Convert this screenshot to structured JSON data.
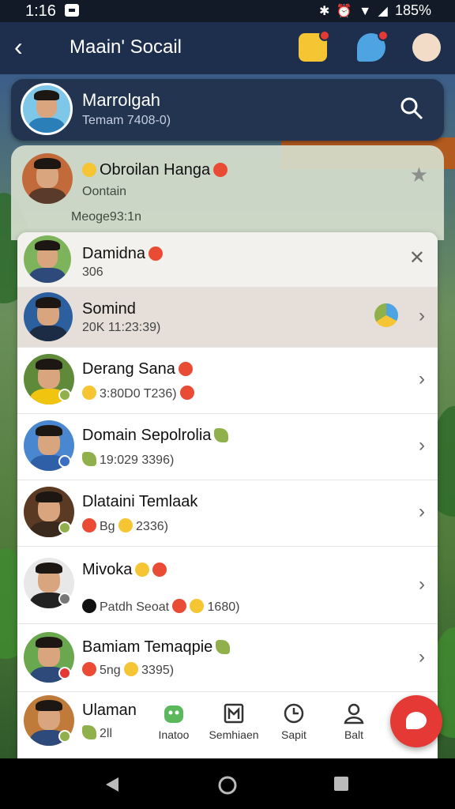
{
  "status_bar": {
    "time": "1:16",
    "battery": "185%"
  },
  "app_bar": {
    "title": "Maain' Socail"
  },
  "profile": {
    "name": "Marrolgah",
    "subtitle": "Temam 7408-0)"
  },
  "group": {
    "name": "Obroilan Hanga",
    "subtitle": "Oontain",
    "message": "Meoge93:1n"
  },
  "contacts": [
    {
      "name": "Damidna",
      "sub": "306"
    },
    {
      "name": "Somind",
      "sub": "20K        11:23:39)"
    },
    {
      "name": "Derang Sana",
      "sub": "3:80D0 T236)"
    },
    {
      "name": "Domain Sepolrolia",
      "sub": "19:029 3396)"
    },
    {
      "name": "Dlataini Temlaak",
      "sub": "Bg",
      "sub2": "2336)"
    },
    {
      "name": "Mivoka",
      "sub": "Patdh Seoat",
      "sub2": "1680)"
    },
    {
      "name": "Bamiam Temaqpie",
      "sub": "5ng",
      "sub2": "3395)"
    },
    {
      "name": "Ulaman",
      "sub": "2ll"
    }
  ],
  "bottom_nav": [
    {
      "label": "Inatoo",
      "icon": "robot-icon"
    },
    {
      "label": "Semhiaen",
      "icon": "calendar-icon"
    },
    {
      "label": "Sapit",
      "icon": "clock-icon"
    },
    {
      "label": "Balt",
      "icon": "person-icon"
    }
  ],
  "colors": {
    "accent": "#e53935",
    "header": "#1e2f4d",
    "card": "#22344f"
  }
}
